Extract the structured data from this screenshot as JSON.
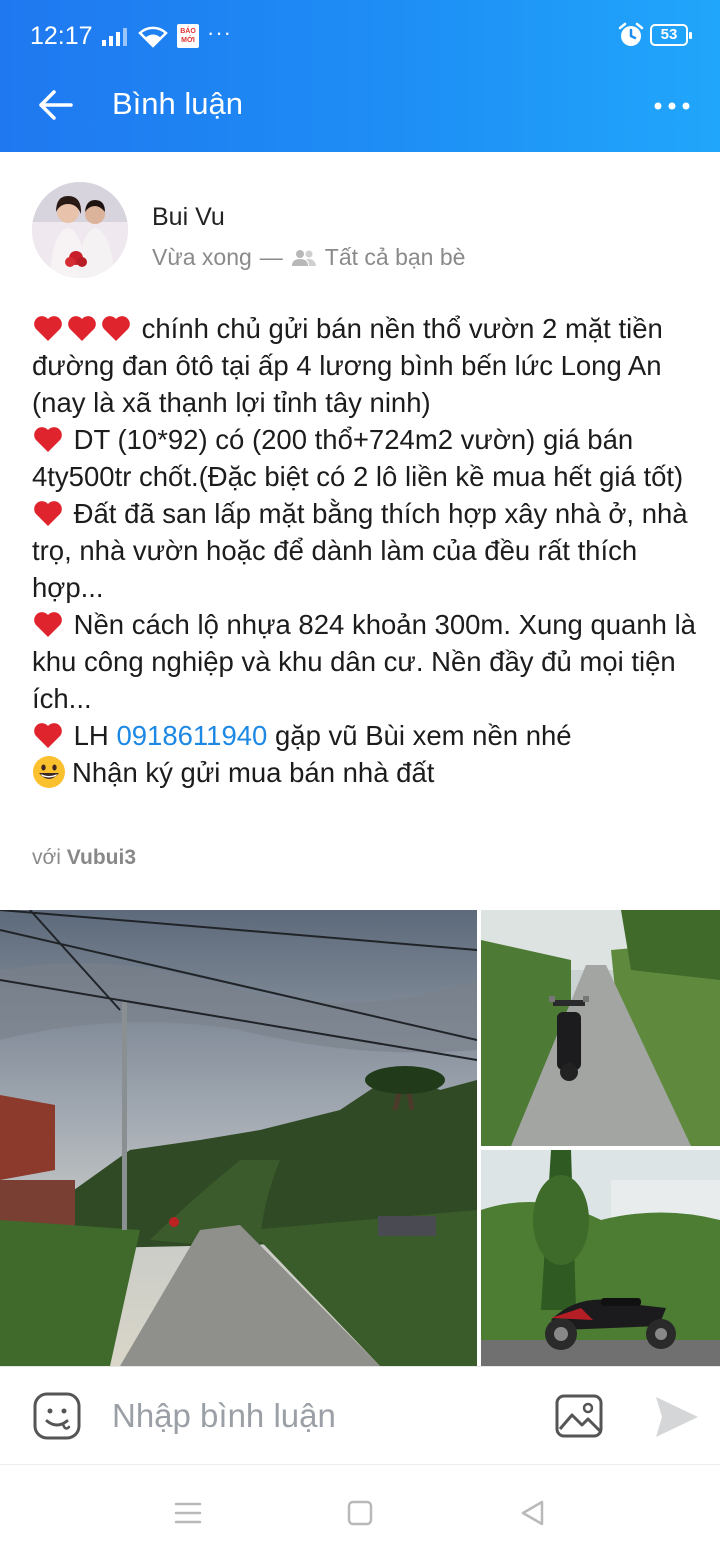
{
  "status_bar": {
    "time": "12:17",
    "battery": "53",
    "notification_icons": [
      "signal-icon",
      "wifi-icon",
      "news-app-icon",
      "more-dots-icon",
      "alarm-icon"
    ],
    "news_app_text": "BÁO MỚI"
  },
  "app_bar": {
    "title": "Bình luận",
    "back_icon": "arrow-left-icon",
    "more_icon": "more-horizontal-icon"
  },
  "post": {
    "author": "Bui Vu",
    "time": "Vừa xong",
    "separator": "—",
    "privacy": "Tất cả bạn bè",
    "lines": [
      {
        "emoji": "hearts3",
        "text": "chính chủ gửi bán nền thổ vườn 2 mặt tiền đường đan ôtô tại ấp 4 lương bình bến lức Long An (nay là xã thạnh lợi tỉnh tây ninh)"
      },
      {
        "emoji": "heart",
        "text": "DT (10*92) có (200 thổ+724m2 vườn) giá bán 4ty500tr chốt.(Đặc biệt có 2 lô liền kề mua hết giá tốt)"
      },
      {
        "emoji": "heart",
        "text": "Đất đã san lấp mặt bằng thích hợp xây nhà ở, nhà trọ, nhà vườn hoặc để dành làm của đều rất thích hợp..."
      },
      {
        "emoji": "heart",
        "text": "Nền cách lộ nhựa 824 khoản 300m. Xung quanh là khu công nghiệp và khu dân cư. Nền đầy đủ mọi tiện ích..."
      }
    ],
    "contact_prefix": "LH",
    "phone": "0918611940",
    "contact_suffix": "gặp vũ Bùi xem nền nhé",
    "last_line": "Nhận ký gửi mua bán nhà đất",
    "tag_prefix": "với",
    "tag_name": "Vubui3",
    "photos": [
      "road-sunset-photo",
      "motorbike-lane-photo",
      "motorbike-lot-photo"
    ]
  },
  "composer": {
    "placeholder": "Nhập bình luận",
    "sticker_icon": "sticker-smile-icon",
    "image_icon": "image-icon",
    "send_icon": "send-icon"
  },
  "nav": {
    "icons": [
      "menu-icon",
      "home-square-icon",
      "back-triangle-icon"
    ]
  },
  "colors": {
    "header_start": "#1f78f0",
    "header_end": "#20a6fb",
    "link": "#1e88e5",
    "heart": "#e0242e"
  }
}
